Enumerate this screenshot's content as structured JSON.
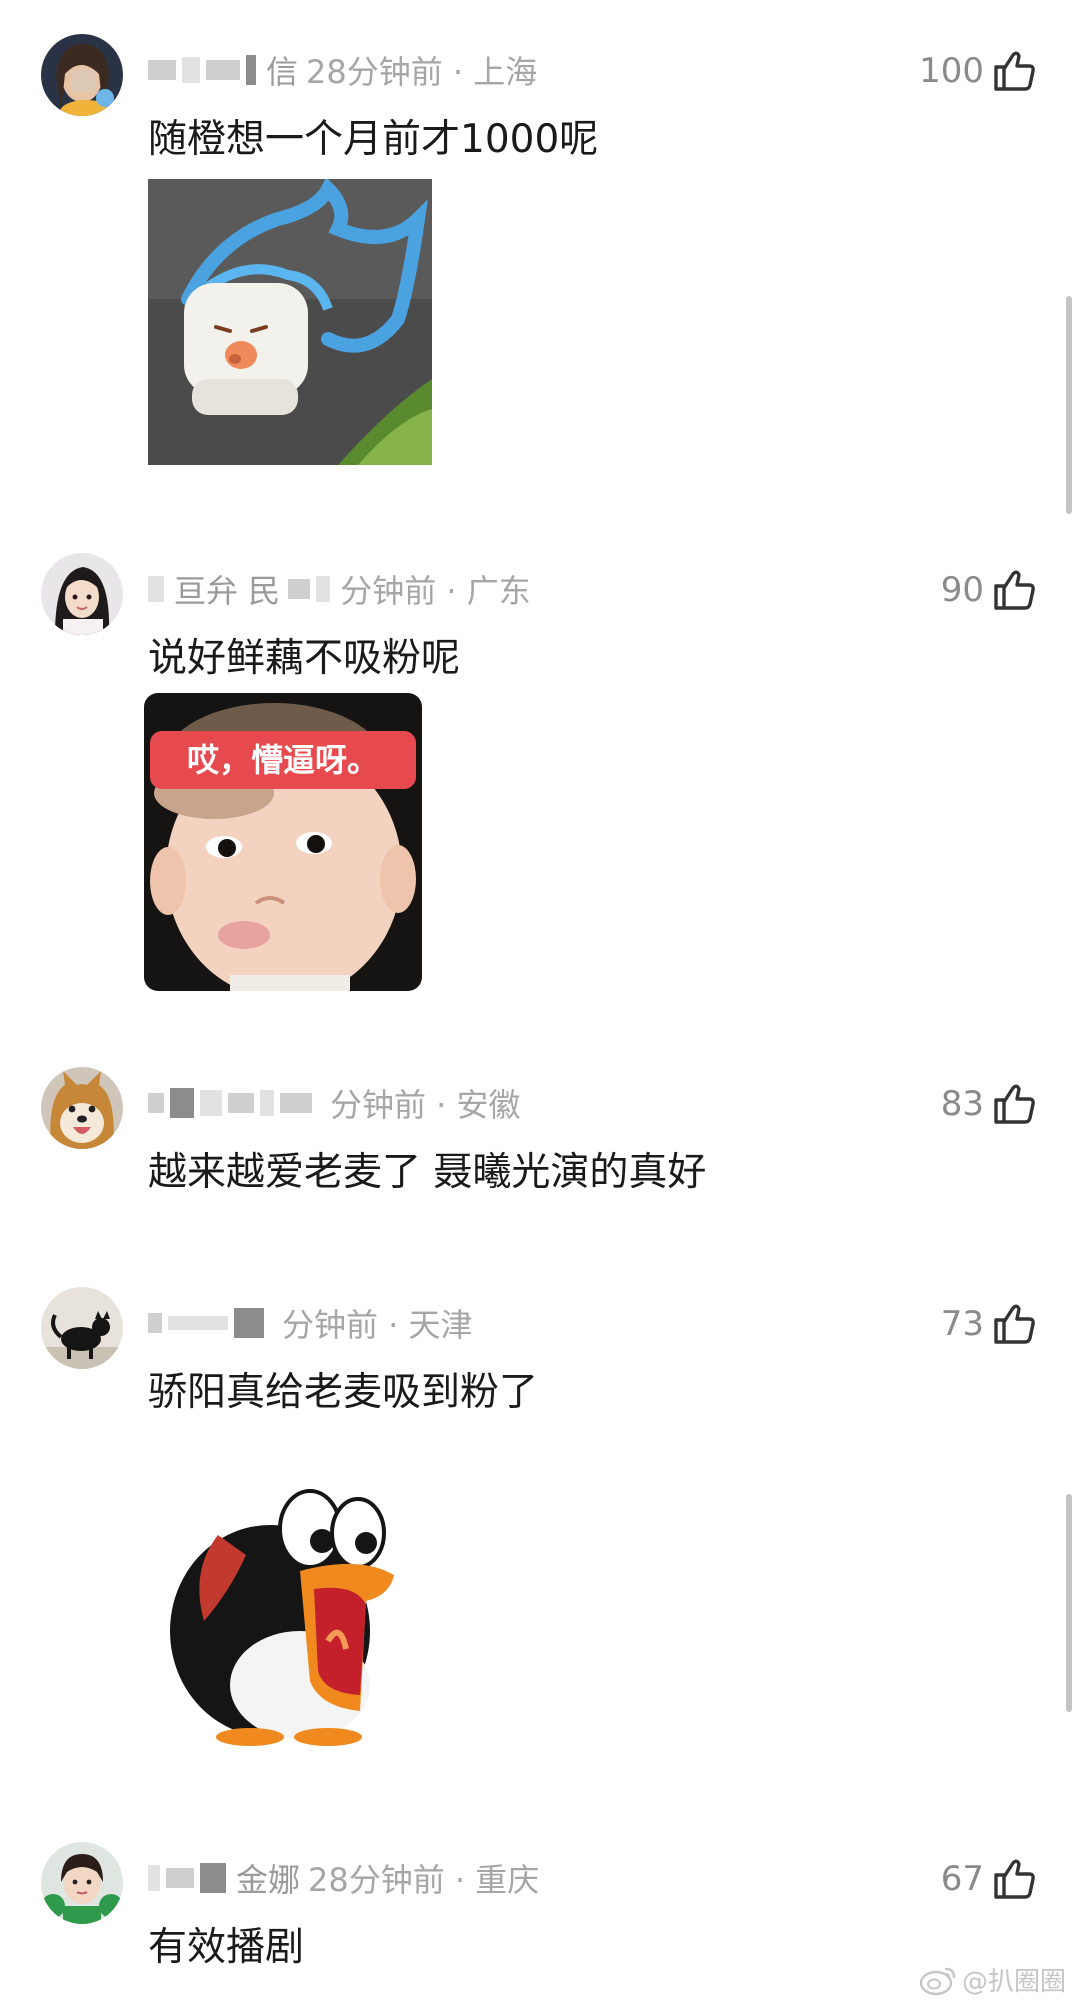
{
  "comments": [
    {
      "name_visible": "信",
      "time_location": "28分钟前 · 上海",
      "likes": "100",
      "text": "随橙想一个月前才1000呢",
      "avatar": "avatar-girl-icon",
      "sticker": "white-blob-cartoon-sticker"
    },
    {
      "name_visible": "亘弁 民",
      "time_location": "分钟前 · 广东",
      "likes": "90",
      "text": "说好鲜藕不吸粉呢",
      "avatar": "avatar-girl-icon",
      "sticker": "baby-meme-sticker",
      "sticker_caption": "哎，懵逼呀。"
    },
    {
      "name_visible": "",
      "time_location": "分钟前 · 安徽",
      "likes": "83",
      "text": "越来越爱老麦了 聂曦光演的真好",
      "avatar": "avatar-shiba-dog-icon"
    },
    {
      "name_visible": "",
      "time_location": "分钟前 · 天津",
      "likes": "73",
      "text": "骄阳真给老麦吸到粉了",
      "avatar": "avatar-black-cat-icon",
      "sticker": "shouting-penguin-sticker"
    },
    {
      "name_visible": "金娜",
      "time_location": "28分钟前 · 重庆",
      "likes": "67",
      "text": "有效播剧",
      "avatar": "avatar-girl-green-icon"
    }
  ],
  "watermark": "@扒圈圈",
  "colors": {
    "meta_gray": "#a6a6a6",
    "text_dark": "#1a1a1a",
    "sticker_red": "#e6494e"
  }
}
